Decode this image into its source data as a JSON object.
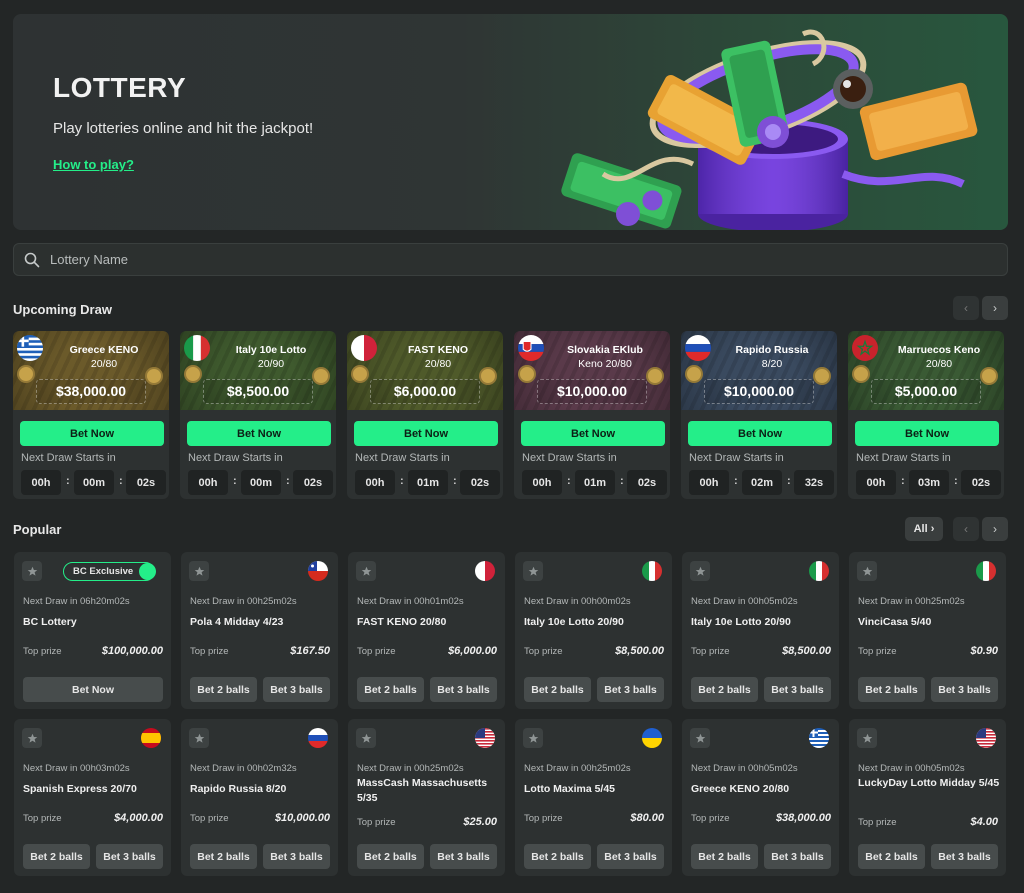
{
  "banner": {
    "title": "LOTTERY",
    "subtitle": "Play lotteries online and hit the jackpot!",
    "link": "How to play?"
  },
  "search": {
    "placeholder": "Lottery Name"
  },
  "upcoming": {
    "title": "Upcoming Draw",
    "bet_label": "Bet Now",
    "next_label": "Next Draw Starts in",
    "cards": [
      {
        "name": "Greece KENO",
        "sub": "20/80",
        "amount": "$38,000.00",
        "h": "00h",
        "m": "00m",
        "s": "02s",
        "color": "#6b5a2a",
        "flag": "greece"
      },
      {
        "name": "Italy 10e Lotto",
        "sub": "20/90",
        "amount": "$8,500.00",
        "h": "00h",
        "m": "00m",
        "s": "02s",
        "color": "#3f5a2e",
        "flag": "italy"
      },
      {
        "name": "FAST KENO",
        "sub": "20/80",
        "amount": "$6,000.00",
        "h": "00h",
        "m": "01m",
        "s": "02s",
        "color": "#4f5a2a",
        "flag": "malta"
      },
      {
        "name": "Slovakia EKlub",
        "sub": "Keno 20/80",
        "amount": "$10,000.00",
        "h": "00h",
        "m": "01m",
        "s": "02s",
        "color": "#5a3a4a",
        "flag": "slovakia"
      },
      {
        "name": "Rapido Russia",
        "sub": "8/20",
        "amount": "$10,000.00",
        "h": "00h",
        "m": "02m",
        "s": "32s",
        "color": "#3a4a5f",
        "flag": "russia"
      },
      {
        "name": "Marruecos Keno",
        "sub": "20/80",
        "amount": "$5,000.00",
        "h": "00h",
        "m": "03m",
        "s": "02s",
        "color": "#3a5a34",
        "flag": "morocco"
      }
    ]
  },
  "popular": {
    "title": "Popular",
    "all_label": "All",
    "prize_label": "Top prize",
    "bet2_label": "Bet 2 balls",
    "bet3_label": "Bet 3 balls",
    "bet_now_label": "Bet Now",
    "exclusive_label": "BC Exclusive",
    "row1": [
      {
        "next": "Next Draw in 06h20m02s",
        "name": "BC Lottery",
        "prize": "$100,000.00",
        "flag": "bc"
      },
      {
        "next": "Next Draw in 00h25m02s",
        "name": "Pola 4 Midday 4/23",
        "prize": "$167.50",
        "flag": "chile"
      },
      {
        "next": "Next Draw in 00h01m02s",
        "name": "FAST KENO 20/80",
        "prize": "$6,000.00",
        "flag": "malta"
      },
      {
        "next": "Next Draw in 00h00m02s",
        "name": "Italy 10e Lotto 20/90",
        "prize": "$8,500.00",
        "flag": "italy"
      },
      {
        "next": "Next Draw in 00h05m02s",
        "name": "Italy 10e Lotto 20/90",
        "prize": "$8,500.00",
        "flag": "italy"
      },
      {
        "next": "Next Draw in 00h25m02s",
        "name": "VinciCasa 5/40",
        "prize": "$0.90",
        "flag": "italy"
      }
    ],
    "row2": [
      {
        "next": "Next Draw in 00h03m02s",
        "name": "Spanish Express 20/70",
        "prize": "$4,000.00",
        "flag": "spain"
      },
      {
        "next": "Next Draw in 00h02m32s",
        "name": "Rapido Russia 8/20",
        "prize": "$10,000.00",
        "flag": "russia"
      },
      {
        "next": "Next Draw in 00h25m02s",
        "name": "MassCash Massachusetts 5/35",
        "prize": "$25.00",
        "flag": "usa"
      },
      {
        "next": "Next Draw in 00h25m02s",
        "name": "Lotto Maxima 5/45",
        "prize": "$80.00",
        "flag": "ukraine"
      },
      {
        "next": "Next Draw in 00h05m02s",
        "name": "Greece KENO 20/80",
        "prize": "$38,000.00",
        "flag": "greece"
      },
      {
        "next": "Next Draw in 00h05m02s",
        "name": "LuckyDay Lotto Midday 5/45",
        "prize": "$4.00",
        "flag": "usa"
      }
    ]
  },
  "colors": {
    "accent": "#24ee89",
    "bg": "#232626",
    "card": "#2d3131"
  }
}
